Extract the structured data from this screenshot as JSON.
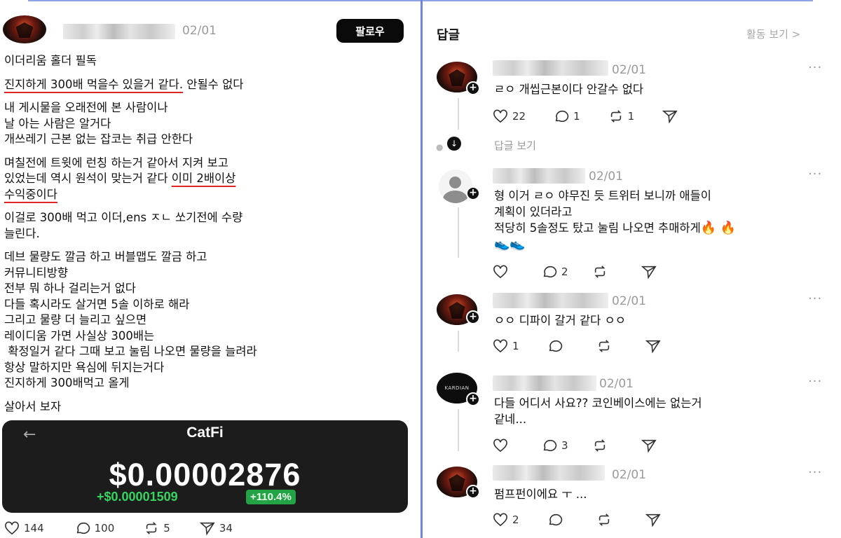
{
  "left_post": {
    "date": "02/01",
    "follow_label": "팔로우",
    "paragraphs": [
      [
        "이더리움 홀더 필독"
      ],
      [
        "진지하게 300배 먹을수 있을거 같다. 안될수 없다"
      ],
      [
        "내 게시물을 오래전에 본 사람이나",
        "날 아는 사람은 알거다",
        "개쓰레기 근본 없는 잡코는 취급 안한다"
      ],
      [
        "며칠전에 트윗에 런칭 하는거 같아서 지켜 보고",
        "있었는데 역시 원석이 맞는거 같다 이미 2배이상",
        "수익중이다"
      ],
      [
        "이걸로 300배 먹고 이더,ens ㅈㄴ 쏘기전에 수량",
        "늘린다."
      ],
      [
        "데브 물량도 깔금 하고 버블맵도 깔금 하고",
        "커뮤니티방향",
        "전부 뭐 하나 걸리는거 없다",
        "다들 혹시라도 살거면 5솔 이하로 해라",
        "그리고 물량 더 늘리고 싶으면",
        "레이디움 가면 사실상 300배는",
        " 확정일거 같다 그때 보고 눌림 나오면 물량을 늘려라",
        "항상 말하지만 욕심에 뒤지는거다",
        "진지하게 300배먹고 올게"
      ],
      [
        "살아서 보자"
      ]
    ],
    "underline_1_a": "진지하게 300배 먹을수 있을거 같다.",
    "underline_1_b": " 안될수 없다",
    "underline_2_pre": "있었는데 역시 원석이 맞는거 같다 ",
    "underline_2_u": "이미 2배이상",
    "underline_2_next": "수익중이다",
    "card": {
      "back_icon": "arrow-left-icon",
      "ticker": "CatFi",
      "price": "$0.00002876",
      "change": "+$0.00001509",
      "change_pct": "+110.4%"
    },
    "actions": {
      "likes": "144",
      "comments": "100",
      "reposts": "5",
      "shares": "34"
    }
  },
  "right_panel": {
    "title": "답글",
    "activity_link": "활동 보기 >",
    "more_icon": "···",
    "replies": [
      {
        "date": "02/01",
        "lines": [
          "ㄹㅇ 개씹근본이다 안갈수 없다"
        ],
        "likes": "22",
        "comments": "1",
        "reposts": "1"
      },
      {
        "date": "02/01",
        "lines": [
          "형 이거 ㄹㅇ 야무진 듯 트위터 보니까 애들이",
          "계획이 있더라고",
          "적당히 5솔정도 탔고 눌림 나오면 추매하게"
        ],
        "likes": "",
        "comments": "2",
        "reposts": ""
      },
      {
        "date": "02/01",
        "lines": [
          "ㅇㅇ 디파이 갈거 같다 ㅇㅇ"
        ],
        "likes": "1",
        "comments": "",
        "reposts": ""
      },
      {
        "date": "02/01",
        "lines": [
          "다들 어디서 사요?? 코인베이스에는 없는거",
          "같네..."
        ],
        "likes": "",
        "comments": "3",
        "reposts": ""
      },
      {
        "date": "02/01",
        "lines": [
          "펌프펀이에요 ㅜ ..."
        ],
        "likes": "2",
        "comments": "",
        "reposts": ""
      }
    ],
    "view_replies": "답글 보기",
    "reply4_avatar_text": "KARDIAN"
  },
  "colors": {
    "accent_underline": "#e02525",
    "divider": "#6f86e0",
    "price_green": "#37d461"
  }
}
